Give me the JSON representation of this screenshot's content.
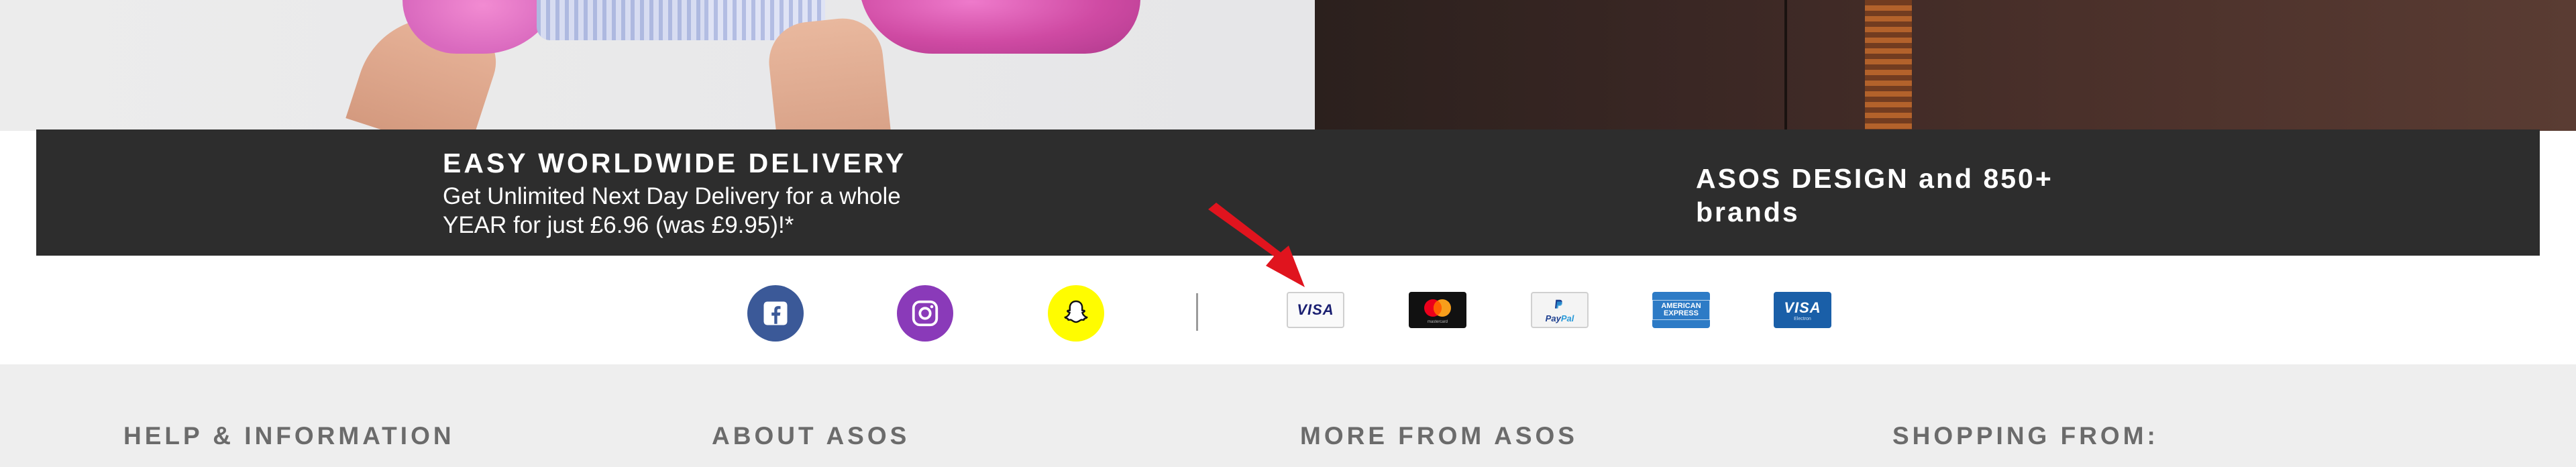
{
  "banner": {
    "left_title": "EASY WORLDWIDE DELIVERY",
    "left_subtitle": "Get Unlimited Next Day Delivery for a whole YEAR for just £6.96 (was £9.95)!*",
    "right_title": "ASOS DESIGN and 850+ brands"
  },
  "social": {
    "icons": [
      "facebook-icon",
      "instagram-icon",
      "snapchat-icon"
    ],
    "colors": {
      "facebook": "#3b5998",
      "instagram": "#8a3ab9",
      "snapchat": "#fffc00"
    }
  },
  "payment": {
    "visa_label": "VISA",
    "visa_electron_label": "VISA",
    "visa_electron_sub": "Electron",
    "mastercard_sub": "mastercard",
    "paypal_label_1": "Pay",
    "paypal_label_2": "Pal",
    "amex_label": "AMERICAN EXPRESS"
  },
  "annotation": {
    "arrow_color": "#e0141e"
  },
  "footer": {
    "columns": [
      "HELP & INFORMATION",
      "ABOUT ASOS",
      "MORE FROM ASOS",
      "SHOPPING FROM:"
    ]
  }
}
